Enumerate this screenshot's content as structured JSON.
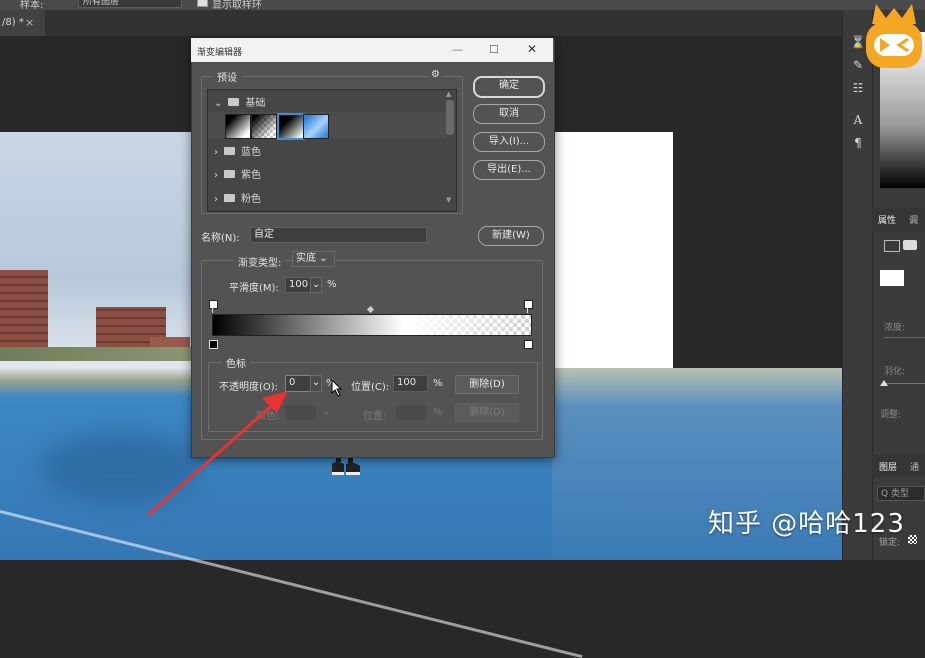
{
  "optionbar": {
    "sample_label": "样本:",
    "sample_value": "所有图层",
    "ring_label": "显示取样环"
  },
  "document_tab": {
    "label": "/8) *",
    "close": "×"
  },
  "dialog": {
    "title": "渐变编辑器",
    "controls": {
      "minimize": "—",
      "maximize": "☐",
      "close": "✕"
    },
    "presets": {
      "label": "预设",
      "gear": "⚙",
      "folders": [
        {
          "name": "基础",
          "expanded": true
        },
        {
          "name": "蓝色",
          "expanded": false
        },
        {
          "name": "紫色",
          "expanded": false
        },
        {
          "name": "粉色",
          "expanded": false
        }
      ],
      "swatches": [
        "black-white",
        "black-transparent",
        "foreground-background",
        "blue-gradient"
      ]
    },
    "buttons": {
      "ok": "确定",
      "cancel": "取消",
      "import": "导入(I)...",
      "export": "导出(E)...",
      "new": "新建(W)"
    },
    "name_label": "名称(N):",
    "name_value": "自定",
    "gradient_type_label": "渐变类型:",
    "gradient_type_value": "实底",
    "smoothness_label": "平滑度(M):",
    "smoothness_value": "100",
    "percent": "%",
    "stops": {
      "label": "色标",
      "opacity_label": "不透明度(O):",
      "opacity_value": "0",
      "location_label": "位置(C):",
      "location_value": "100",
      "delete_label": "删除(D)",
      "color_label": "颜色:",
      "location2_label": "位置:",
      "delete2_label": "删除(D)"
    }
  },
  "right_panel": {
    "properties_tab": "属性",
    "adjust_tab": "调",
    "layers_tab": "图层",
    "channels_tab": "通",
    "search_placeholder": "Q 类型",
    "lock_label": "锁定:",
    "opacity_label": "浓度:",
    "feather_label": "羽化:",
    "adjust_label": "调整:"
  },
  "tool_icons": [
    "history-icon",
    "brush-settings-icon",
    "adjustments-icon",
    "character-icon",
    "paragraph-icon"
  ],
  "watermark": "知乎 @哈哈123",
  "colors": {
    "dialog_bg": "#535353",
    "titlebar": "#f2f2f2",
    "annotation_arrow": "#e8332f",
    "accent_logo": "#f5a623"
  }
}
